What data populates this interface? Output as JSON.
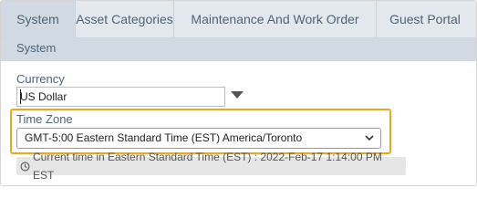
{
  "tabs": [
    {
      "label": "System",
      "active": true
    },
    {
      "label": "Asset Categories",
      "active": false
    },
    {
      "label": "Maintenance And Work Order",
      "active": false
    },
    {
      "label": "Guest Portal",
      "active": false
    }
  ],
  "section": {
    "title": "System"
  },
  "currency": {
    "label": "Currency",
    "value": "US Dollar"
  },
  "timezone": {
    "label": "Time Zone",
    "selected": "GMT-5:00 Eastern Standard Time (EST) America/Toronto",
    "highlight_color": "#f2a516"
  },
  "current_time": {
    "icon": "clock-icon",
    "text": "Current time in Eastern Standard Time (EST) : 2022-Feb-17 1:14:00 PM EST"
  }
}
